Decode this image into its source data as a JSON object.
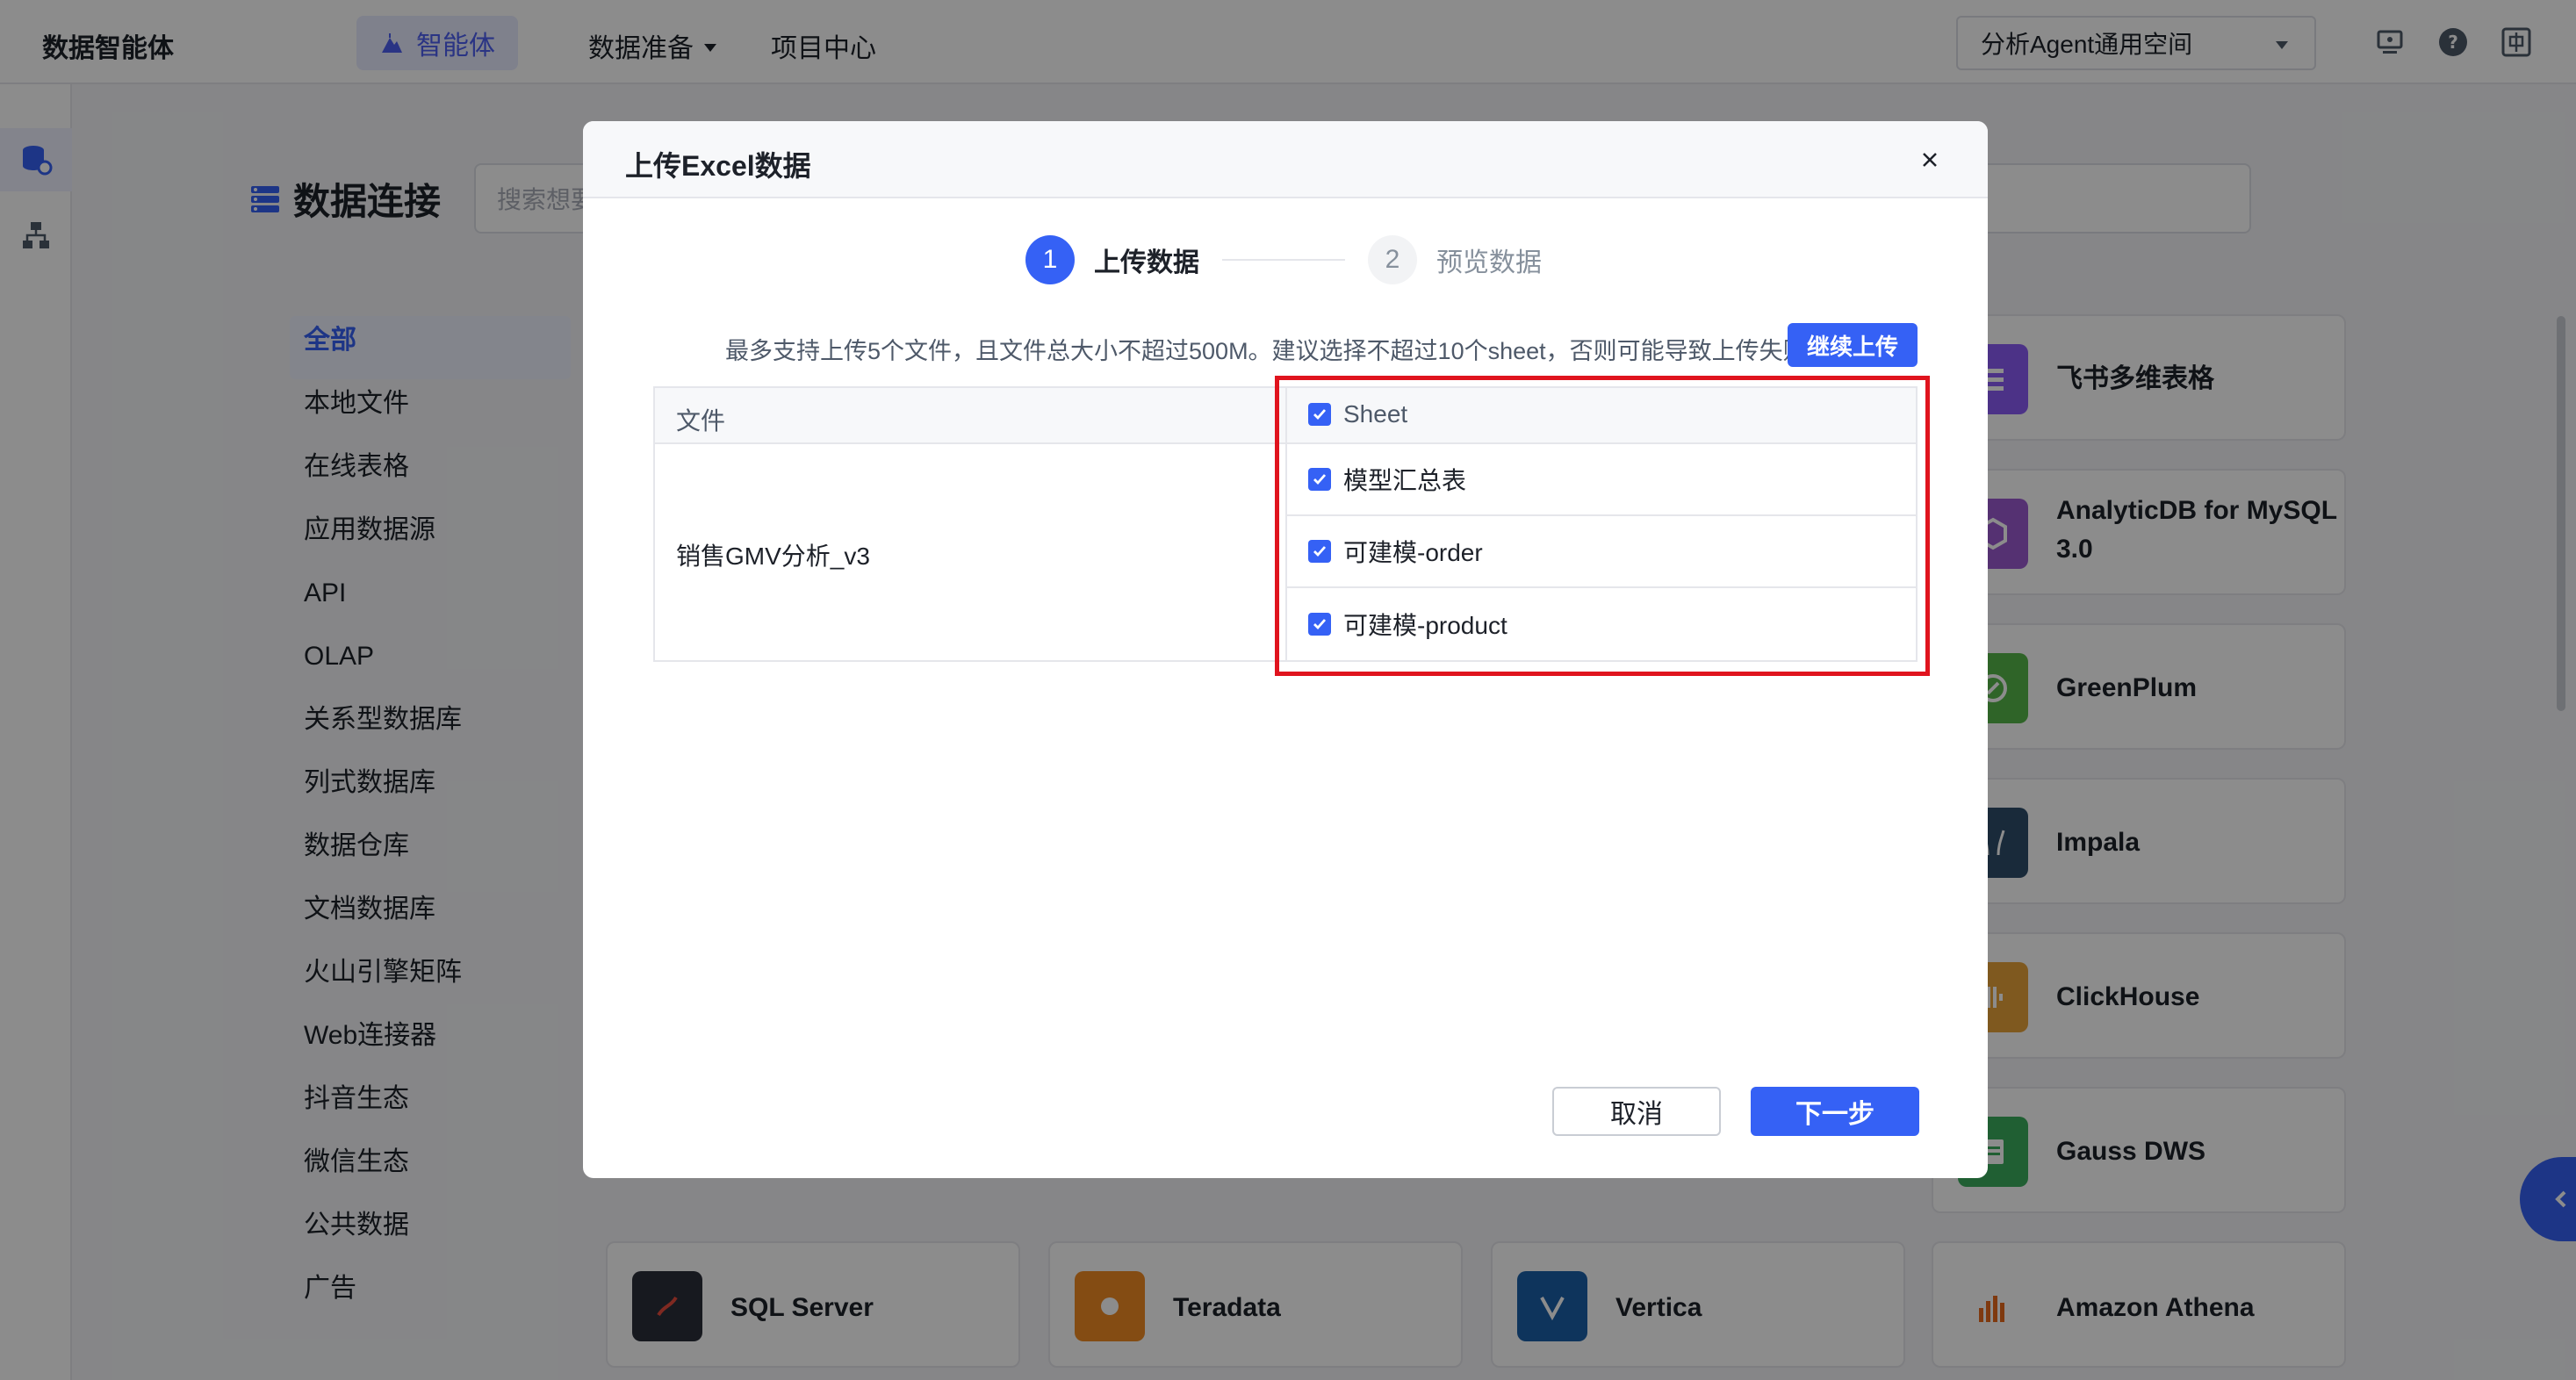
{
  "nav": {
    "brand": "数据智能体",
    "agent_tab": "智能体",
    "data_prep": "数据准备",
    "project_center": "项目中心",
    "workspace": "分析Agent通用空间"
  },
  "page": {
    "title": "数据连接",
    "search_placeholder": "搜索想要"
  },
  "categories": [
    "全部",
    "本地文件",
    "在线表格",
    "应用数据源",
    "API",
    "OLAP",
    "关系型数据库",
    "列式数据库",
    "数据仓库",
    "文档数据库",
    "火山引擎矩阵",
    "Web连接器",
    "抖音生态",
    "微信生态",
    "公共数据",
    "广告"
  ],
  "cards": {
    "feishu": "飞书多维表格",
    "analyticdb": "AnalyticDB for MySQL 3.0",
    "greenplum": "GreenPlum",
    "impala": "Impala",
    "clickhouse": "ClickHouse",
    "gauss": "Gauss DWS",
    "sqlserver": "SQL Server",
    "teradata": "Teradata",
    "vertica": "Vertica",
    "athena": "Amazon Athena"
  },
  "modal": {
    "title": "上传Excel数据",
    "steps": [
      {
        "num": "1",
        "label": "上传数据"
      },
      {
        "num": "2",
        "label": "预览数据"
      }
    ],
    "hint": "最多支持上传5个文件，且文件总大小不超过500M。建议选择不超过10个sheet，否则可能导致上传失败",
    "continue_label": "继续上传",
    "col_file": "文件",
    "col_sheet": "Sheet",
    "file_name": "销售GMV分析_v3",
    "sheets": [
      "模型汇总表",
      "可建模-order",
      "可建模-product"
    ],
    "cancel_label": "取消",
    "next_label": "下一步"
  },
  "colors": {
    "accent": "#3561f5",
    "highlight_border": "#e0141e"
  }
}
